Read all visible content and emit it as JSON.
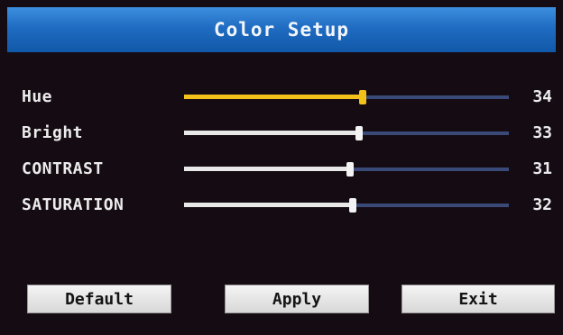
{
  "window": {
    "title": "Color Setup",
    "accent_color": "#1f6cc2",
    "background_color": "#150b13"
  },
  "settings": [
    {
      "label": "Hue",
      "value": "34",
      "level": 0.55,
      "selected": true
    },
    {
      "label": "Bright",
      "value": "33",
      "level": 0.54,
      "selected": false
    },
    {
      "label": "CONTRAST",
      "value": "31",
      "level": 0.51,
      "selected": false
    },
    {
      "label": "SATURATION",
      "value": "32",
      "level": 0.52,
      "selected": false
    }
  ],
  "buttons": {
    "default_label": "Default",
    "apply_label": "Apply",
    "exit_label": "Exit"
  }
}
